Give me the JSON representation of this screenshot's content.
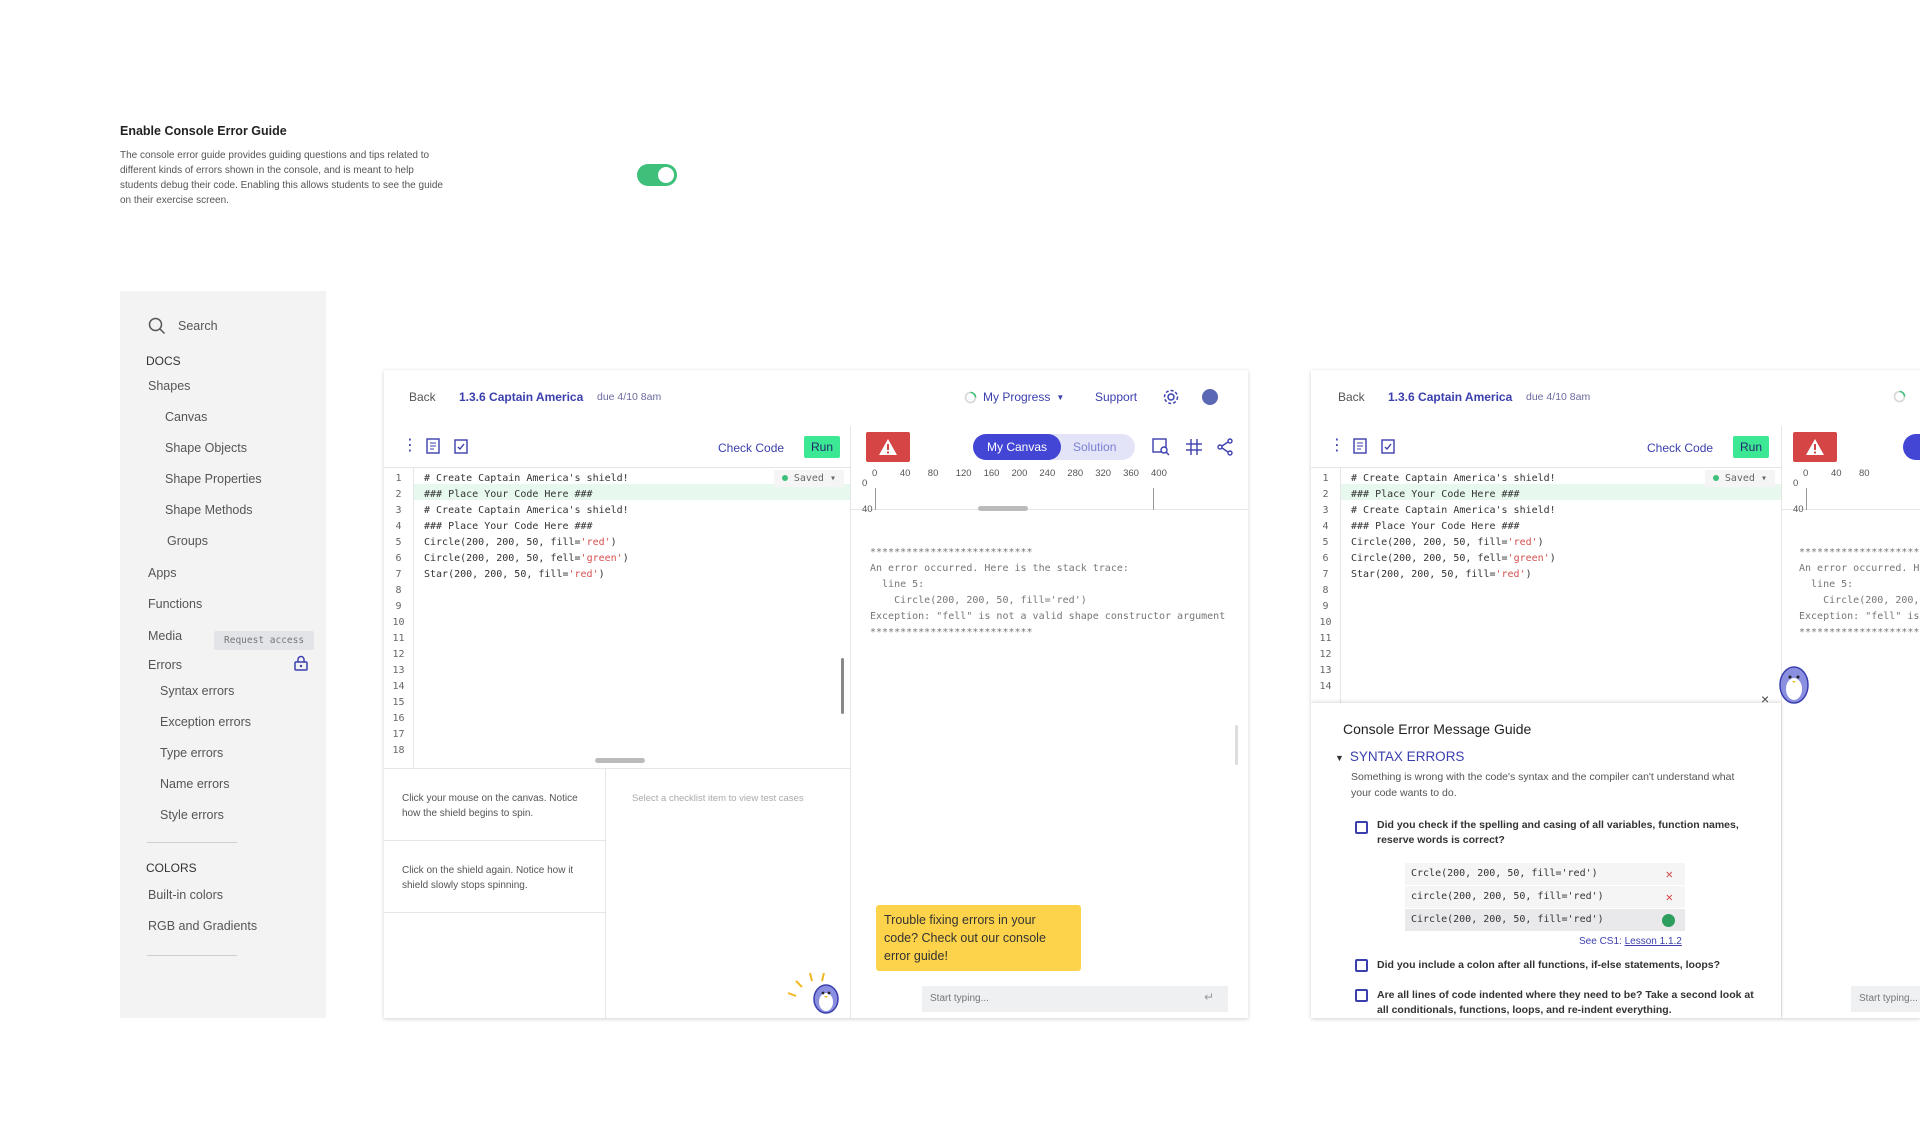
{
  "setting": {
    "title": "Enable Console Error Guide",
    "description": "The console error guide provides guiding questions and tips related to different kinds of errors shown in the console, and is meant to help students debug their code. Enabling this allows students to see the guide on their exercise screen.",
    "toggle_state": "on"
  },
  "sidebar": {
    "search_placeholder": "Search",
    "docs_heading": "DOCS",
    "colors_heading": "COLORS",
    "items": [
      "Shapes",
      "Canvas",
      "Shape Objects",
      "Shape Properties",
      "Shape Methods",
      "Groups",
      "Apps",
      "Functions",
      "Media",
      "Errors",
      "Syntax errors",
      "Exception errors",
      "Type errors",
      "Name errors",
      "Style errors"
    ],
    "color_items": [
      "Built-in colors",
      "RGB and Gradients"
    ],
    "request_access": "Request access"
  },
  "ide": {
    "back": "Back",
    "title": "1.3.6 Captain America",
    "due": "due 4/10 8am",
    "progress": "My Progress",
    "support": "Support",
    "check_code": "Check Code",
    "run": "Run",
    "saved": "Saved",
    "tabs": [
      "My Canvas",
      "Solution"
    ],
    "ruler_x": [
      "0",
      "40",
      "80",
      "120",
      "160",
      "200",
      "240",
      "280",
      "320",
      "360",
      "400"
    ],
    "ruler_y": [
      "0",
      "40"
    ],
    "line_numbers": [
      "1",
      "2",
      "3",
      "4",
      "5",
      "6",
      "7",
      "8",
      "9",
      "10",
      "11",
      "12",
      "13",
      "14",
      "15",
      "16",
      "17",
      "18"
    ],
    "console": {
      "stars": "***************************",
      "l1": "An error occurred. Here is the stack trace:",
      "l2": "  line 5:",
      "l3": "    Circle(200, 200, 50, fill='red')",
      "l4": "Exception: \"fell\" is not a valid shape constructor argument",
      "stars2": "***************************"
    },
    "checklist": {
      "item1": "Click your mouse on the canvas. Notice how the shield begins to spin.",
      "item2": "Click on the shield again. Notice how it shield slowly stops spinning.",
      "placeholder": "Select a checklist item to view test cases"
    },
    "tooltip": "Trouble fixing errors in your code? Check out our console error guide!",
    "input_placeholder": "Start typing..."
  },
  "ide2_console": {
    "l1": "An error occurred. He",
    "l2": "  line 5:",
    "l3": "    Circle(200, 200,",
    "l4": "Exception: \"fell\" is"
  },
  "guide": {
    "title": "Console Error Message Guide",
    "close": "×",
    "section": "SYNTAX ERRORS",
    "intro": "Something is wrong with the code's syntax and the compiler can't understand what your code wants to do.",
    "q1": "Did you check if the spelling and casing of all variables, function names, reserve words is correct?",
    "examples": [
      "Crcle(200, 200, 50, fill='red')",
      "circle(200, 200, 50, fill='red')",
      "Circle(200, 200, 50, fill='red')"
    ],
    "see_prefix": "See CS1: ",
    "see_link": "Lesson 1.1.2",
    "q2": "Did you include a colon after all functions, if-else statements, loops?",
    "q3": "Are all lines of code indented where they need to be? Take a second look at all conditionals, functions, loops, and re-indent everything."
  },
  "colors": {
    "accent": "#3b3fad",
    "run": "#3de894",
    "toggle": "#3ec07a",
    "warning": "#d64545",
    "tooltip": "#fcd34a"
  }
}
